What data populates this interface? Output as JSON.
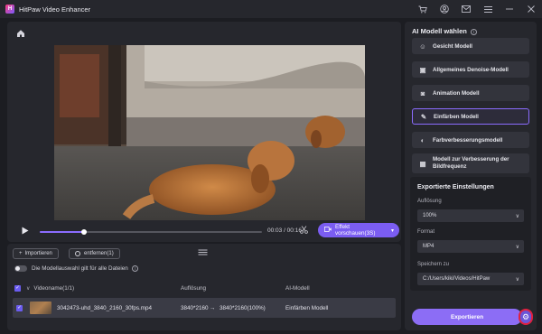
{
  "window": {
    "title": "HitPaw Video Enhancer",
    "logo_text": "H",
    "icons": [
      "cart-icon",
      "user-icon",
      "mail-icon",
      "menu-icon",
      "minimize-icon",
      "close-icon"
    ]
  },
  "player": {
    "time": "00:03 / 00:16",
    "progress": 0.2,
    "preview_label": "Effekt vorschauen(3S)"
  },
  "file_toolbar": {
    "import_label": "Importieren",
    "remove_label": "entfernen(1)"
  },
  "apply_all": {
    "label": "Die Modellauswahl gilt für alle Dateien",
    "enabled": false
  },
  "table": {
    "headers": {
      "name": "Videoname(1/1)",
      "resolution": "Auflösung",
      "model": "AI-Modell"
    },
    "rows": [
      {
        "name": "3042473-uhd_3840_2160_30fps.mp4",
        "resolution_from": "3840*2160",
        "arrow": "→",
        "resolution_to": "3840*2160(100%)",
        "model": "Einfärben Modell"
      }
    ]
  },
  "models": {
    "title": "AI Modell wählen",
    "items": [
      {
        "label": "Gesicht Modell",
        "icon": "face-icon"
      },
      {
        "label": "Allgemeines Denoise-Modell",
        "icon": "image-icon"
      },
      {
        "label": "Animation Modell",
        "icon": "animation-icon"
      },
      {
        "label": "Einfärben Modell",
        "icon": "colorize-icon",
        "selected": true
      },
      {
        "label": "Farbverbesserungsmodell",
        "icon": "palette-icon"
      },
      {
        "label": "Modell zur Verbesserung der Bildfrequenz",
        "icon": "frames-icon"
      }
    ]
  },
  "export": {
    "title": "Exportierte Einstellungen",
    "resolution_label": "Auflösung",
    "resolution_value": "100%",
    "format_label": "Format",
    "format_value": "MP4",
    "save_label": "Speichern zu",
    "save_value": "C:/Users/kiki/Videos/HitPaw",
    "export_button": "Exportieren"
  },
  "colors": {
    "accent": "#8c6df5",
    "panel": "#26272d",
    "background": "#1c1d22"
  }
}
